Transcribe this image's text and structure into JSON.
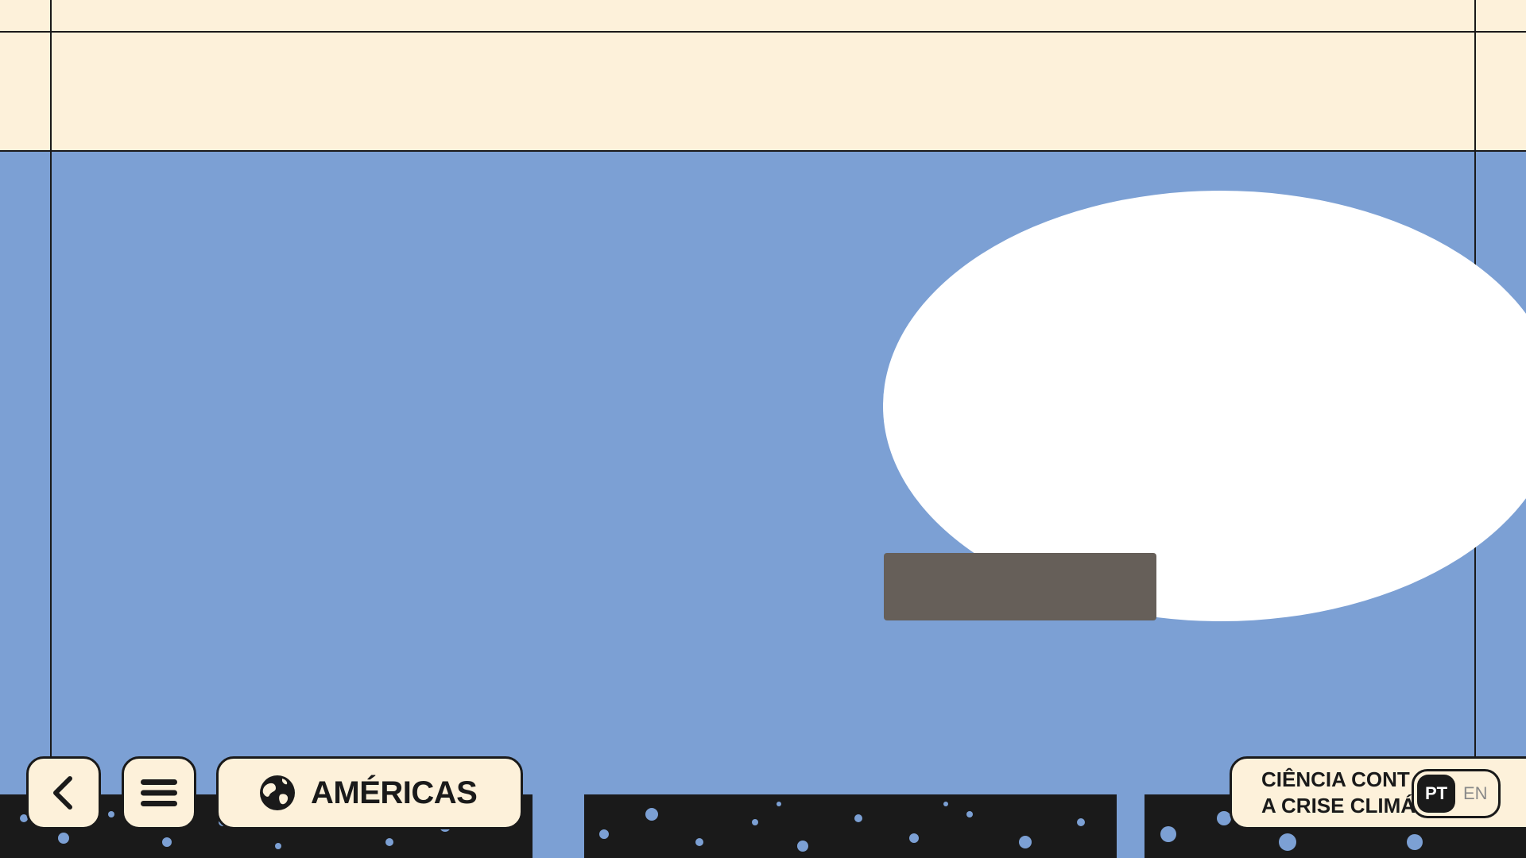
{
  "colors": {
    "sky": "#7ca0d4",
    "cream": "#fdf1da",
    "ink": "#1a1a1a",
    "blob": "#ffffff",
    "block": "#665f59"
  },
  "nav": {
    "back_icon": "chevron-left-icon",
    "menu_icon": "hamburger-menu-icon",
    "region_icon": "globe-icon",
    "region_label": "AMÉRICAS"
  },
  "title": {
    "line1": "CIÊNCIA CONT",
    "line2": "A CRISE CLIMÁ"
  },
  "language": {
    "active": "PT",
    "inactive": "EN"
  }
}
